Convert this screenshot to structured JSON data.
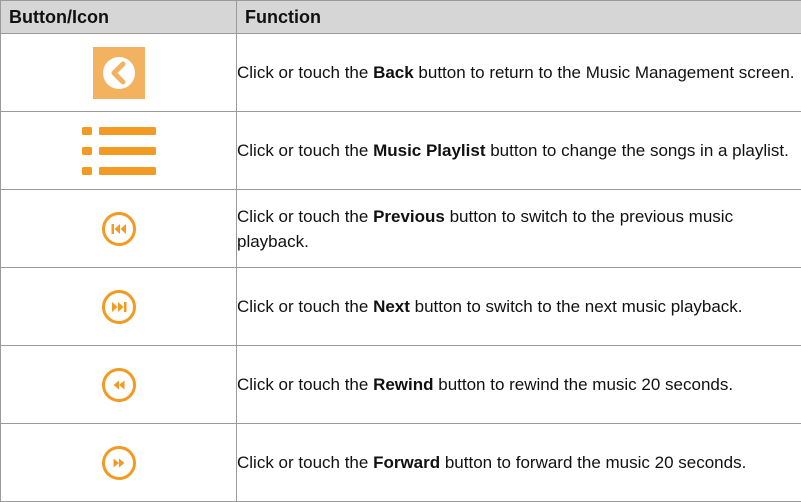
{
  "header": {
    "col_button": "Button/Icon",
    "col_function": "Function"
  },
  "rows": [
    {
      "icon": "back-icon",
      "pre": "Click or touch the ",
      "bold": "Back",
      "post": " button to return to the Music Management screen."
    },
    {
      "icon": "playlist-icon",
      "pre": "Click or touch the ",
      "bold": "Music Playlist",
      "post": " button to change the songs in a playlist."
    },
    {
      "icon": "previous-icon",
      "pre": "Click or touch the ",
      "bold": "Previous",
      "post": " button to switch to the previous music playback."
    },
    {
      "icon": "next-icon",
      "pre": "Click or touch the ",
      "bold": "Next",
      "post": " button to switch to the next music playback."
    },
    {
      "icon": "rewind-icon",
      "pre": "Click or touch the ",
      "bold": "Rewind",
      "post": " button to rewind the music 20 seconds."
    },
    {
      "icon": "forward-icon",
      "pre": "Click or touch the ",
      "bold": "Forward",
      "post": " button to forward the music 20 seconds."
    }
  ],
  "colors": {
    "accent": "#f39a22",
    "back_bg": "#f3b25f",
    "header_bg": "#d6d6d6",
    "border": "#9a9a9a"
  }
}
